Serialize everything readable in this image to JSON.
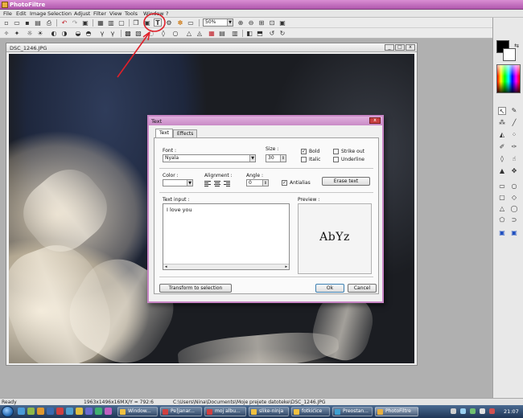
{
  "app": {
    "title": "PhotoFiltre"
  },
  "menu": [
    "File",
    "Edit",
    "Image",
    "Selection",
    "Adjust",
    "Filter",
    "View",
    "Tools",
    "Window",
    "?"
  ],
  "toolbar": {
    "zoom_value": "50%"
  },
  "image_window": {
    "title": "DSC_1246.JPG",
    "min_label": "_",
    "max_label": "□",
    "close_label": "x"
  },
  "dialog": {
    "title": "Text",
    "close_label": "x",
    "tabs": [
      "Text",
      "Effects"
    ],
    "font_label": "Font :",
    "font_value": "Nyala",
    "size_label": "Size :",
    "size_value": "30",
    "bold_label": "Bold",
    "italic_label": "Italic",
    "strikeout_label": "Strike out",
    "underline_label": "Underline",
    "bold_checked": true,
    "italic_checked": false,
    "strikeout_checked": false,
    "underline_checked": false,
    "color_label": "Color :",
    "alignment_label": "Alignment :",
    "angle_label": "Angle :",
    "angle_value": "0",
    "antialias_label": "Antialias",
    "antialias_checked": true,
    "erase_text_button": "Erase text",
    "text_input_label": "Text input :",
    "text_input_value": "I love you",
    "preview_label": "Preview :",
    "preview_text": "AbYz",
    "transform_button": "Transform to selection",
    "ok_button": "Ok",
    "cancel_button": "Cancel"
  },
  "status": {
    "state": "Ready",
    "dimensions": "1963x1496x16M",
    "coords": "X/Y = 792:6",
    "path": "C:\\Users\\Nina\\Documents\\Moje prejete datoteke\\DSC_1246.JPG"
  },
  "taskbar": {
    "buttons": [
      "Window...",
      "Pe]janar...",
      "moj albu...",
      "slike-ninja",
      "fotkićice",
      "Preostan...",
      "PhotoFiltre"
    ],
    "clock": "21:07"
  },
  "colors": {
    "title_bar": "#b058ad",
    "dialog_frame": "#c886c5",
    "annotation": "#e0202a",
    "foreground_swatch": "#000000",
    "background_swatch": "#ffffff"
  }
}
